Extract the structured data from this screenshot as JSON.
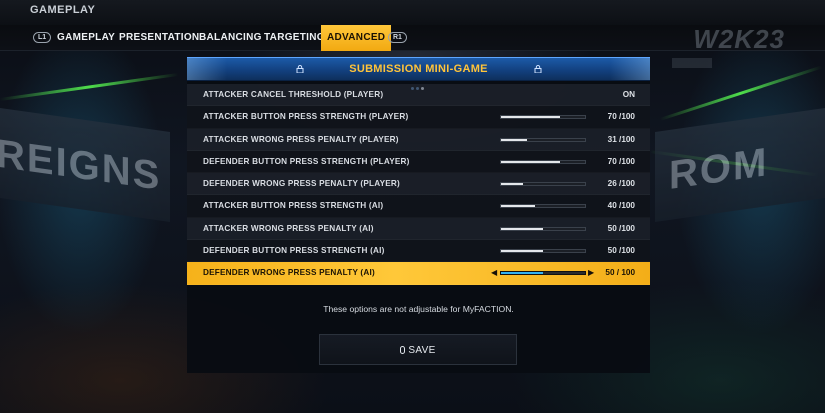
{
  "header": {
    "page_title": "GAMEPLAY",
    "brand": "W2K23",
    "left_bumper": "L1",
    "right_bumper": "R1"
  },
  "tabs": [
    {
      "label": "GAMEPLAY",
      "active": false
    },
    {
      "label": "PRESENTATION",
      "active": false
    },
    {
      "label": "BALANCING",
      "active": false
    },
    {
      "label": "TARGETING",
      "active": false
    },
    {
      "label": "ADVANCED",
      "active": true
    }
  ],
  "panel": {
    "title": "SUBMISSION MINI-GAME",
    "page_dots": 3,
    "active_dot": 3,
    "rows": [
      {
        "label": "ATTACKER CANCEL THRESHOLD (PLAYER)",
        "value": "ON",
        "slider": null
      },
      {
        "label": "ATTACKER BUTTON PRESS STRENGTH (PLAYER)",
        "value": "70 /100",
        "slider": 70
      },
      {
        "label": "ATTACKER WRONG PRESS PENALTY (PLAYER)",
        "value": "31 /100",
        "slider": 31
      },
      {
        "label": "DEFENDER BUTTON PRESS STRENGTH (PLAYER)",
        "value": "70 /100",
        "slider": 70
      },
      {
        "label": "DEFENDER WRONG PRESS PENALTY (PLAYER)",
        "value": "26 /100",
        "slider": 26
      },
      {
        "label": "ATTACKER BUTTON PRESS STRENGTH (AI)",
        "value": "40 /100",
        "slider": 40
      },
      {
        "label": "ATTACKER WRONG PRESS PENALTY (AI)",
        "value": "50 /100",
        "slider": 50
      },
      {
        "label": "DEFENDER BUTTON PRESS STRENGTH (AI)",
        "value": "50 /100",
        "slider": 50
      },
      {
        "label": "DEFENDER WRONG PRESS PENALTY (AI)",
        "value": "50 / 100",
        "slider": 50,
        "selected": true
      }
    ],
    "notice": "These options are not adjustable for MyFACTION.",
    "save_label": "SAVE"
  },
  "background": {
    "left_sign": "REIGNS",
    "right_sign": "ROM"
  },
  "colors": {
    "accent": "#ffc43a",
    "header_blue": "#1c5aa8",
    "slider_fill_selected": "#33b2f2"
  }
}
